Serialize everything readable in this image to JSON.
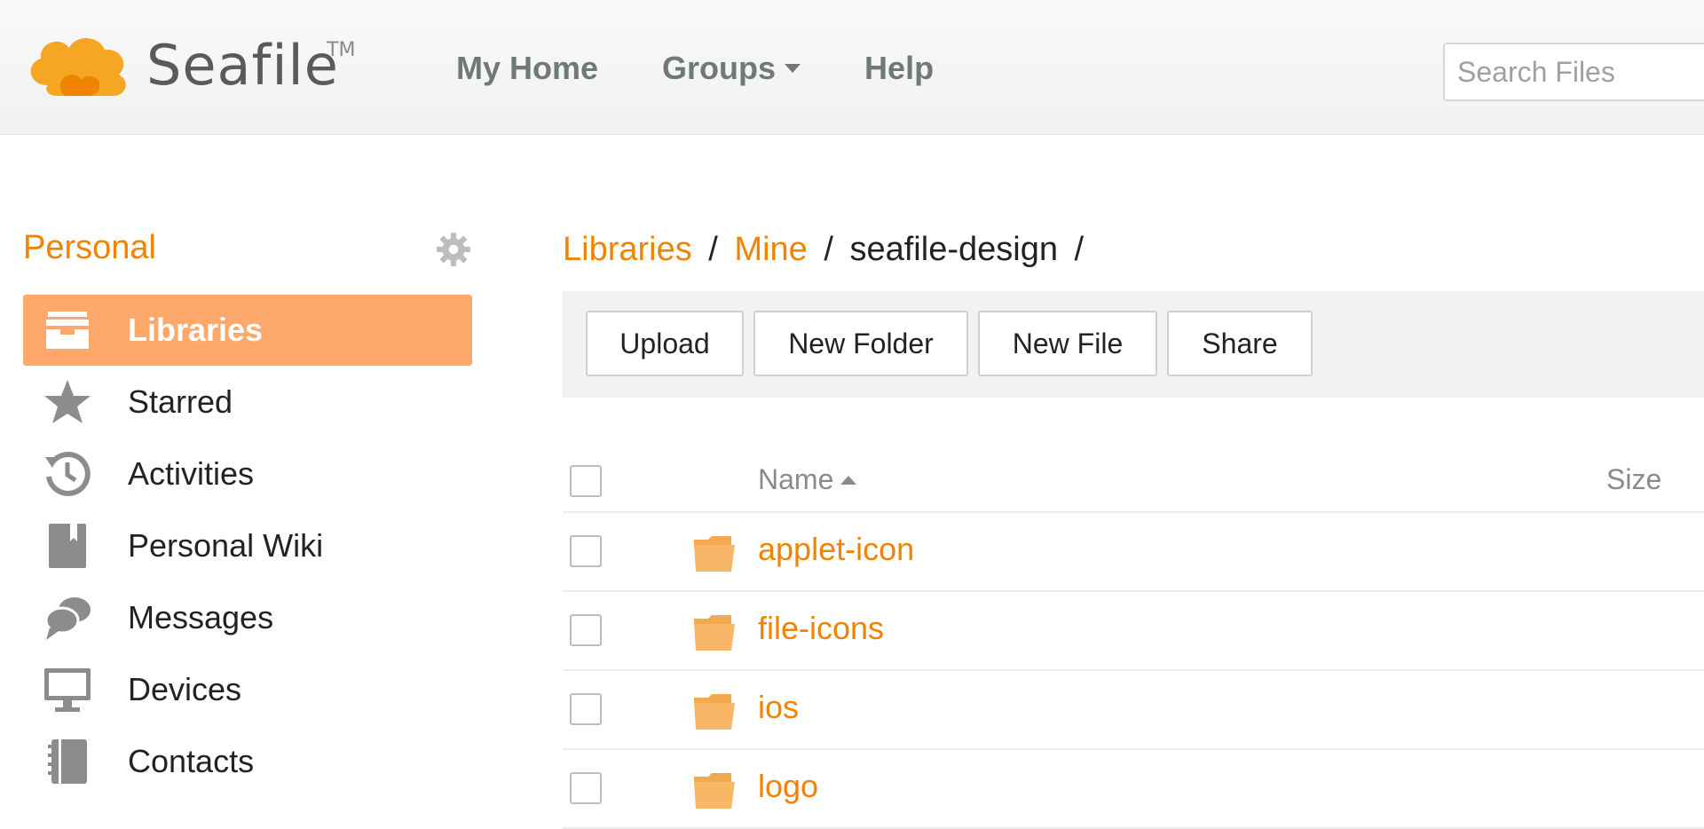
{
  "header": {
    "logo_text": "Seafile",
    "logo_tm": "TM",
    "nav": {
      "my_home": "My Home",
      "groups": "Groups",
      "help": "Help"
    },
    "search": {
      "placeholder": "Search Files",
      "value": ""
    }
  },
  "sidebar": {
    "title": "Personal",
    "items": [
      {
        "label": "Libraries",
        "icon": "libraries-icon",
        "active": true
      },
      {
        "label": "Starred",
        "icon": "star-icon"
      },
      {
        "label": "Activities",
        "icon": "history-icon"
      },
      {
        "label": "Personal Wiki",
        "icon": "wiki-icon"
      },
      {
        "label": "Messages",
        "icon": "messages-icon"
      },
      {
        "label": "Devices",
        "icon": "monitor-icon"
      },
      {
        "label": "Contacts",
        "icon": "contacts-icon"
      }
    ]
  },
  "breadcrumb": {
    "libraries": "Libraries",
    "sep": "/",
    "mine": "Mine",
    "current": "seafile-design",
    "trailing": "/"
  },
  "toolbar": {
    "upload": "Upload",
    "new_folder": "New Folder",
    "new_file": "New File",
    "share": "Share"
  },
  "table": {
    "headers": {
      "name": "Name",
      "size": "Size"
    },
    "rows": [
      {
        "name": "applet-icon",
        "type": "folder"
      },
      {
        "name": "file-icons",
        "type": "folder"
      },
      {
        "name": "ios",
        "type": "folder"
      },
      {
        "name": "logo",
        "type": "folder"
      }
    ]
  },
  "colors": {
    "accent": "#f08300",
    "active_bg": "#ffa86b",
    "nav_text": "#6f7a74",
    "folder": "#f7b766"
  }
}
